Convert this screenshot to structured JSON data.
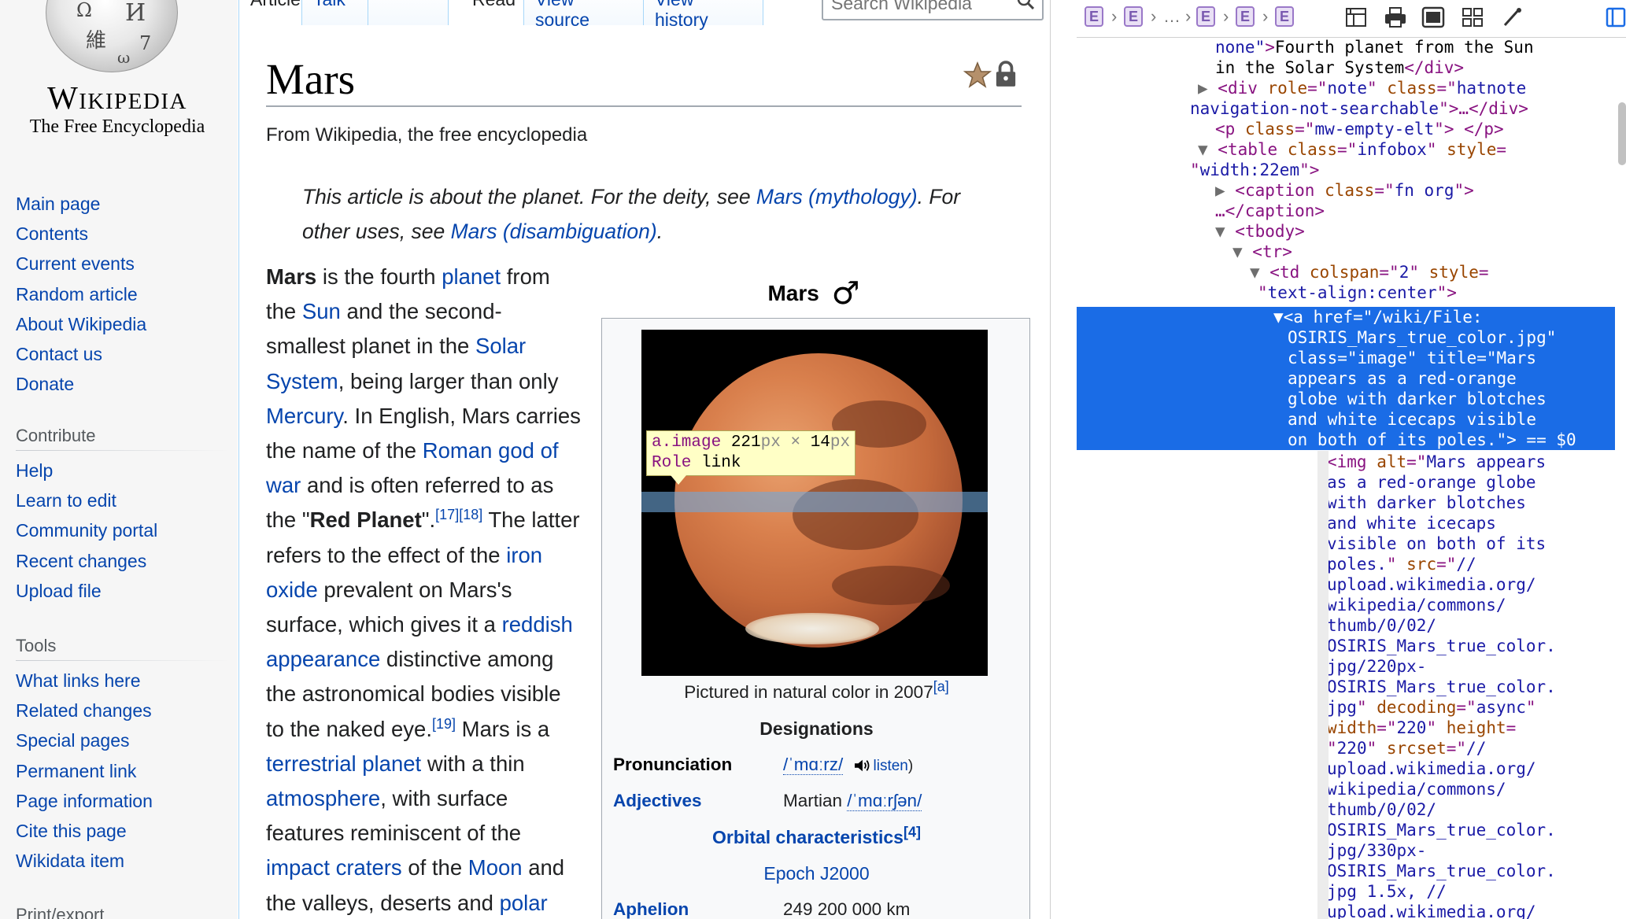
{
  "sidebar": {
    "logo": {
      "wordmark": "Wikipedia",
      "tagline": "The Free Encyclopedia",
      "globe_glyphs": [
        "Ω",
        "И",
        "維",
        "7",
        "ω"
      ]
    },
    "navigation": [
      "Main page",
      "Contents",
      "Current events",
      "Random article",
      "About Wikipedia",
      "Contact us",
      "Donate"
    ],
    "contribute": {
      "heading": "Contribute",
      "items": [
        "Help",
        "Learn to edit",
        "Community portal",
        "Recent changes",
        "Upload file"
      ]
    },
    "tools": {
      "heading": "Tools",
      "items": [
        "What links here",
        "Related changes",
        "Special pages",
        "Permanent link",
        "Page information",
        "Cite this page",
        "Wikidata item"
      ]
    },
    "print": {
      "heading": "Print/export"
    }
  },
  "tabs": {
    "article": "Article",
    "talk": "Talk",
    "read": "Read",
    "view_source": "View source",
    "view_history": "View history"
  },
  "search": {
    "placeholder": "Search Wikipedia"
  },
  "article": {
    "title": "Mars",
    "site_sub": "From Wikipedia, the free encyclopedia",
    "hatnote": {
      "t1": "This article is about the planet. For the deity, see ",
      "l1": "Mars (mythology)",
      "t2": ". For other uses, see ",
      "l2": "Mars (disambiguation)",
      "t3": "."
    },
    "lead": {
      "b1": "Mars",
      "t1": " is the fourth ",
      "l1": "planet",
      "t2": " from the ",
      "l2": "Sun",
      "t3": " and the second-smallest planet in the ",
      "l3": "Solar System",
      "t4": ", being larger than only ",
      "l4": "Mercury",
      "t5": ". In English, Mars carries the name of the ",
      "l5": "Roman god of war",
      "t6": " and is often referred to as the \"",
      "b2": "Red Planet",
      "t7": "\".",
      "r1": "[17][18]",
      "t8": " The latter refers to the effect of the ",
      "l6": "iron oxide",
      "t9": " prevalent on Mars's surface, which gives it a ",
      "l7": "reddish appearance",
      "t10": " distinctive among the astronomical bodies visible to the naked eye.",
      "r2": "[19]",
      "t11": " Mars is a ",
      "l8": "terrestrial planet",
      "t12": " with a thin ",
      "l9": "atmosphere",
      "t13": ", with surface features reminiscent of the ",
      "l10": "impact craters",
      "t14": " of the ",
      "l11": "Moon",
      "t15": " and the valleys, deserts and ",
      "l12": "polar"
    }
  },
  "infobox": {
    "title": "Mars",
    "symbol": "♂",
    "image_caption": "Pictured in natural color in 2007",
    "image_caption_ref": "[a]",
    "designations_heading": "Designations",
    "pronunciation_label": "Pronunciation",
    "pronunciation_ipa": "/ˈmɑːrz/",
    "pronunciation_listen": "listen",
    "adjectives_label": "Adjectives",
    "adjectives_value": "Martian",
    "adjectives_ipa": "/ˈmɑːrʃən/",
    "orbital_heading": "Orbital characteristics",
    "orbital_ref": "[4]",
    "epoch": "Epoch J2000",
    "aphelion_label": "Aphelion",
    "aphelion_value": "249 200 000 km"
  },
  "inspector_tooltip": {
    "selector": "a.image",
    "width": "221",
    "height": "14",
    "unit": "px",
    "times": "×",
    "role_label": "Role",
    "role_value": "link"
  },
  "devtools": {
    "breadcrumb_glyph": "E",
    "breadcrumb_ellipsis": "…",
    "lines_above": [
      [
        "s",
        "none\"",
        "t",
        ">",
        "tx",
        "Fourth planet from the Sun"
      ],
      [
        "tx",
        "in the Solar System",
        "t",
        "</div>"
      ],
      [
        "tri",
        "▶ ",
        "t",
        "<div ",
        "an",
        "role",
        "t",
        "=\"",
        "av",
        "note",
        "t",
        "\" ",
        "an",
        "class",
        "t",
        "=\"",
        "av",
        "hatnote"
      ],
      [
        "av",
        "navigation-not-searchable",
        "t",
        "\">…</div>"
      ],
      [
        "t",
        "<p ",
        "an",
        "class",
        "t",
        "=\"",
        "av",
        "mw-empty-elt",
        "t",
        "\"> </p>"
      ],
      [
        "tri",
        "▼ ",
        "t",
        "<table ",
        "an",
        "class",
        "t",
        "=\"",
        "av",
        "infobox",
        "t",
        "\" ",
        "an",
        "style",
        "t",
        "="
      ],
      [
        "t",
        "\"",
        "av",
        "width:22em",
        "t",
        "\">"
      ],
      [
        "tri",
        "▶ ",
        "t",
        "<caption ",
        "an",
        "class",
        "t",
        "=\"",
        "av",
        "fn org",
        "t",
        "\">"
      ],
      [
        "t",
        "…</caption>"
      ],
      [
        "tri",
        "▼ ",
        "t",
        "<tbody>"
      ],
      [
        "tri",
        "▼ ",
        "t",
        "<tr>"
      ],
      [
        "tri",
        "▼ ",
        "t",
        "<td ",
        "an",
        "colspan",
        "t",
        "=\"",
        "av",
        "2",
        "t",
        "\" ",
        "an",
        "style",
        "t",
        "="
      ],
      [
        "t",
        "\"",
        "av",
        "text-align:center",
        "t",
        "\">"
      ]
    ],
    "selected_lines": [
      "▼<a href=\"/wiki/File:",
      "OSIRIS_Mars_true_color.jpg\"",
      "class=\"image\" title=\"Mars",
      "appears as a red-orange",
      "globe with darker blotches",
      "and white icecaps visible",
      "on both of its poles.\"> == $0"
    ],
    "lines_below": [
      [
        "t",
        "<img ",
        "an",
        "alt",
        "t",
        "=\"",
        "av",
        "Mars appears"
      ],
      [
        "av",
        "as a red-orange globe"
      ],
      [
        "av",
        "with darker blotches"
      ],
      [
        "av",
        "and white icecaps"
      ],
      [
        "av",
        "visible on both of its"
      ],
      [
        "av",
        "poles.",
        "t",
        "\" ",
        "an",
        "src",
        "t",
        "=\"",
        "av",
        "//"
      ],
      [
        "av",
        "upload.wikimedia.org/"
      ],
      [
        "av",
        "wikipedia/commons/"
      ],
      [
        "av",
        "thumb/0/02/"
      ],
      [
        "av",
        "OSIRIS_Mars_true_color."
      ],
      [
        "av",
        "jpg/220px-"
      ],
      [
        "av",
        "OSIRIS_Mars_true_color."
      ],
      [
        "av",
        "jpg",
        "t",
        "\" ",
        "an",
        "decoding",
        "t",
        "=\"",
        "av",
        "async",
        "t",
        "\""
      ],
      [
        "an",
        "width",
        "t",
        "=\"",
        "av",
        "220",
        "t",
        "\" ",
        "an",
        "height",
        "t",
        "="
      ],
      [
        "t",
        "\"",
        "av",
        "220",
        "t",
        "\" ",
        "an",
        "srcset",
        "t",
        "=\"",
        "av",
        "//"
      ],
      [
        "av",
        "upload.wikimedia.org/"
      ],
      [
        "av",
        "wikipedia/commons/"
      ],
      [
        "av",
        "thumb/0/02/"
      ],
      [
        "av",
        "OSIRIS_Mars_true_color."
      ],
      [
        "av",
        "jpg/330px-"
      ],
      [
        "av",
        "OSIRIS_Mars_true_color."
      ],
      [
        "av",
        "jpg 1.5x, //"
      ],
      [
        "av",
        "upload.wikimedia.org/"
      ]
    ]
  }
}
